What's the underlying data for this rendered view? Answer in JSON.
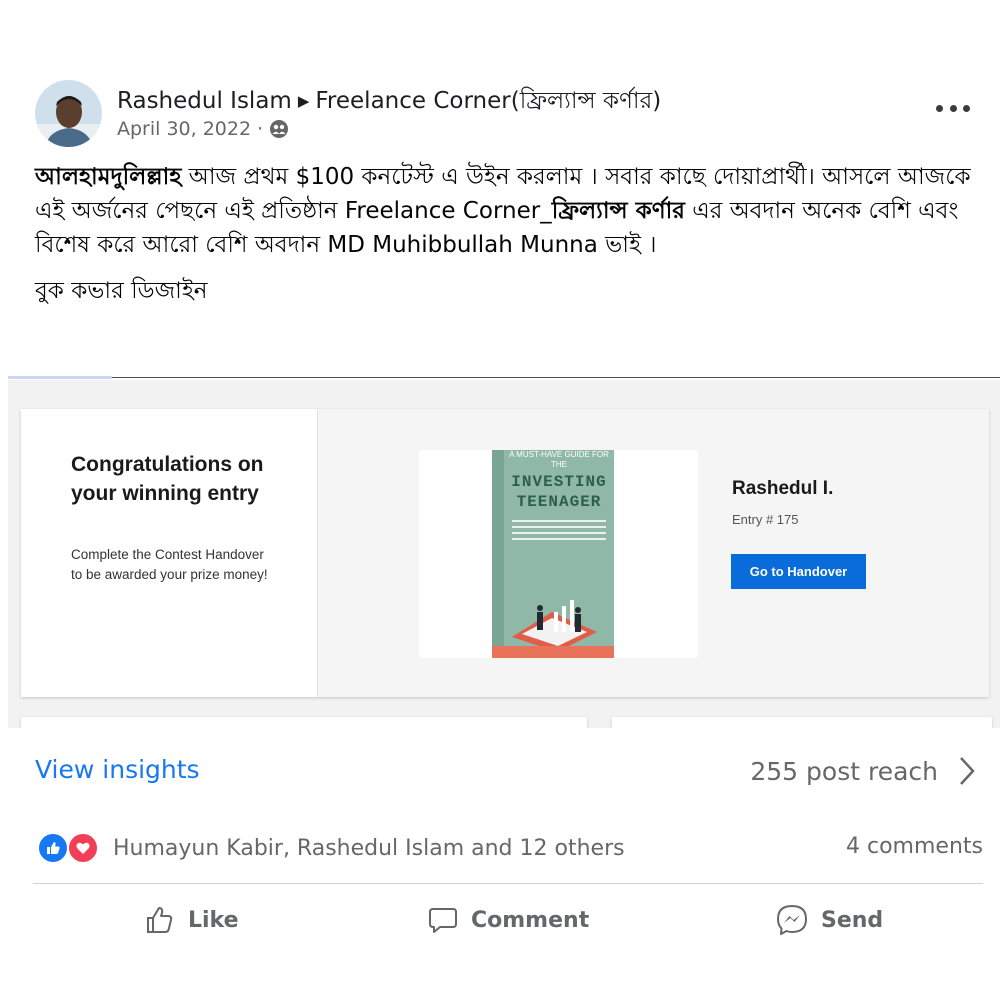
{
  "post": {
    "author": "Rashedul Islam",
    "group": "Freelance Corner(ফ্রিল্যান্স কর্ণার)",
    "date": "April 30, 2022",
    "visibility_icon": "group-audience-icon",
    "text_bold_1": "আলহামদুলিল্লাহ",
    "text_1": " আজ প্রথম $100 কনটেস্ট এ উইন করলাম । সবার কাছে দোয়াপ্রার্থী। আসলে আজকে এই অর্জনের পেছনে এই প্রতিষ্ঠান Freelance Corner_",
    "text_bold_2": "ফ্রিল্যান্স কর্ণার",
    "text_2": " এর অবদান অনেক বেশি এবং বিশেষ করে আরো বেশি অবদান MD Muhibbullah Munna ভাই ।",
    "text_3": "বুক কভার ডিজাইন"
  },
  "embed": {
    "congrats_title": "Congratulations on your winning entry",
    "congrats_sub": "Complete the Contest Handover to be awarded your prize money!",
    "book_top_text": "A MUST-HAVE GUIDE FOR THE",
    "book_title": "INVESTING TEENAGER",
    "winner_name": "Rashedul I.",
    "entry_label": "Entry # 175",
    "handover_button": "Go to Handover"
  },
  "stats": {
    "insights_label": "View insights",
    "reach": "255 post reach",
    "reactors": "Humayun Kabir, Rashedul Islam and 12 others",
    "comments": "4 comments"
  },
  "actions": {
    "like": "Like",
    "comment": "Comment",
    "send": "Send"
  },
  "colors": {
    "link_blue": "#1877f2",
    "love_red": "#f33e58",
    "button_blue": "#0a6cdb",
    "muted_text": "#65676b"
  }
}
